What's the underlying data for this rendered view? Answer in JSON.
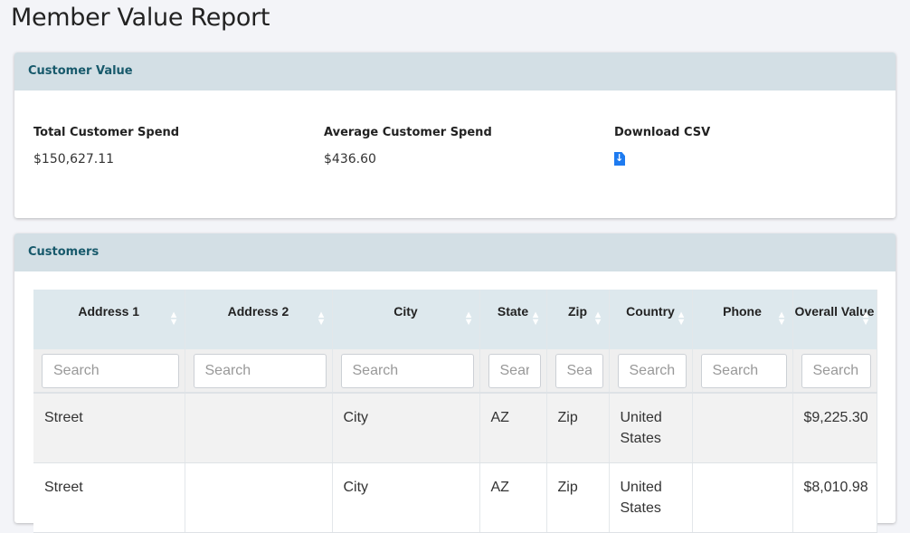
{
  "page_title": "Member Value Report",
  "customer_value": {
    "title": "Customer Value",
    "total_label": "Total Customer Spend",
    "total_value": "$150,627.11",
    "avg_label": "Average Customer Spend",
    "avg_value": "$436.60",
    "download_label": "Download CSV"
  },
  "customers": {
    "title": "Customers",
    "columns": [
      "Address 1",
      "Address 2",
      "City",
      "State",
      "Zip",
      "Country",
      "Phone",
      "Overall Value"
    ],
    "search_placeholder": "Search",
    "rows": [
      {
        "address1": "Street",
        "address2": "",
        "city": "City",
        "state": "AZ",
        "zip": "Zip",
        "country": "United States",
        "phone": "",
        "value": "$9,225.30"
      },
      {
        "address1": "Street",
        "address2": "",
        "city": "City",
        "state": "AZ",
        "zip": "Zip",
        "country": "United States",
        "phone": "",
        "value": "$8,010.98"
      }
    ]
  },
  "colors": {
    "accent": "#1e7bf0",
    "header_bg": "#d3dfe5",
    "header_text": "#17596b"
  }
}
